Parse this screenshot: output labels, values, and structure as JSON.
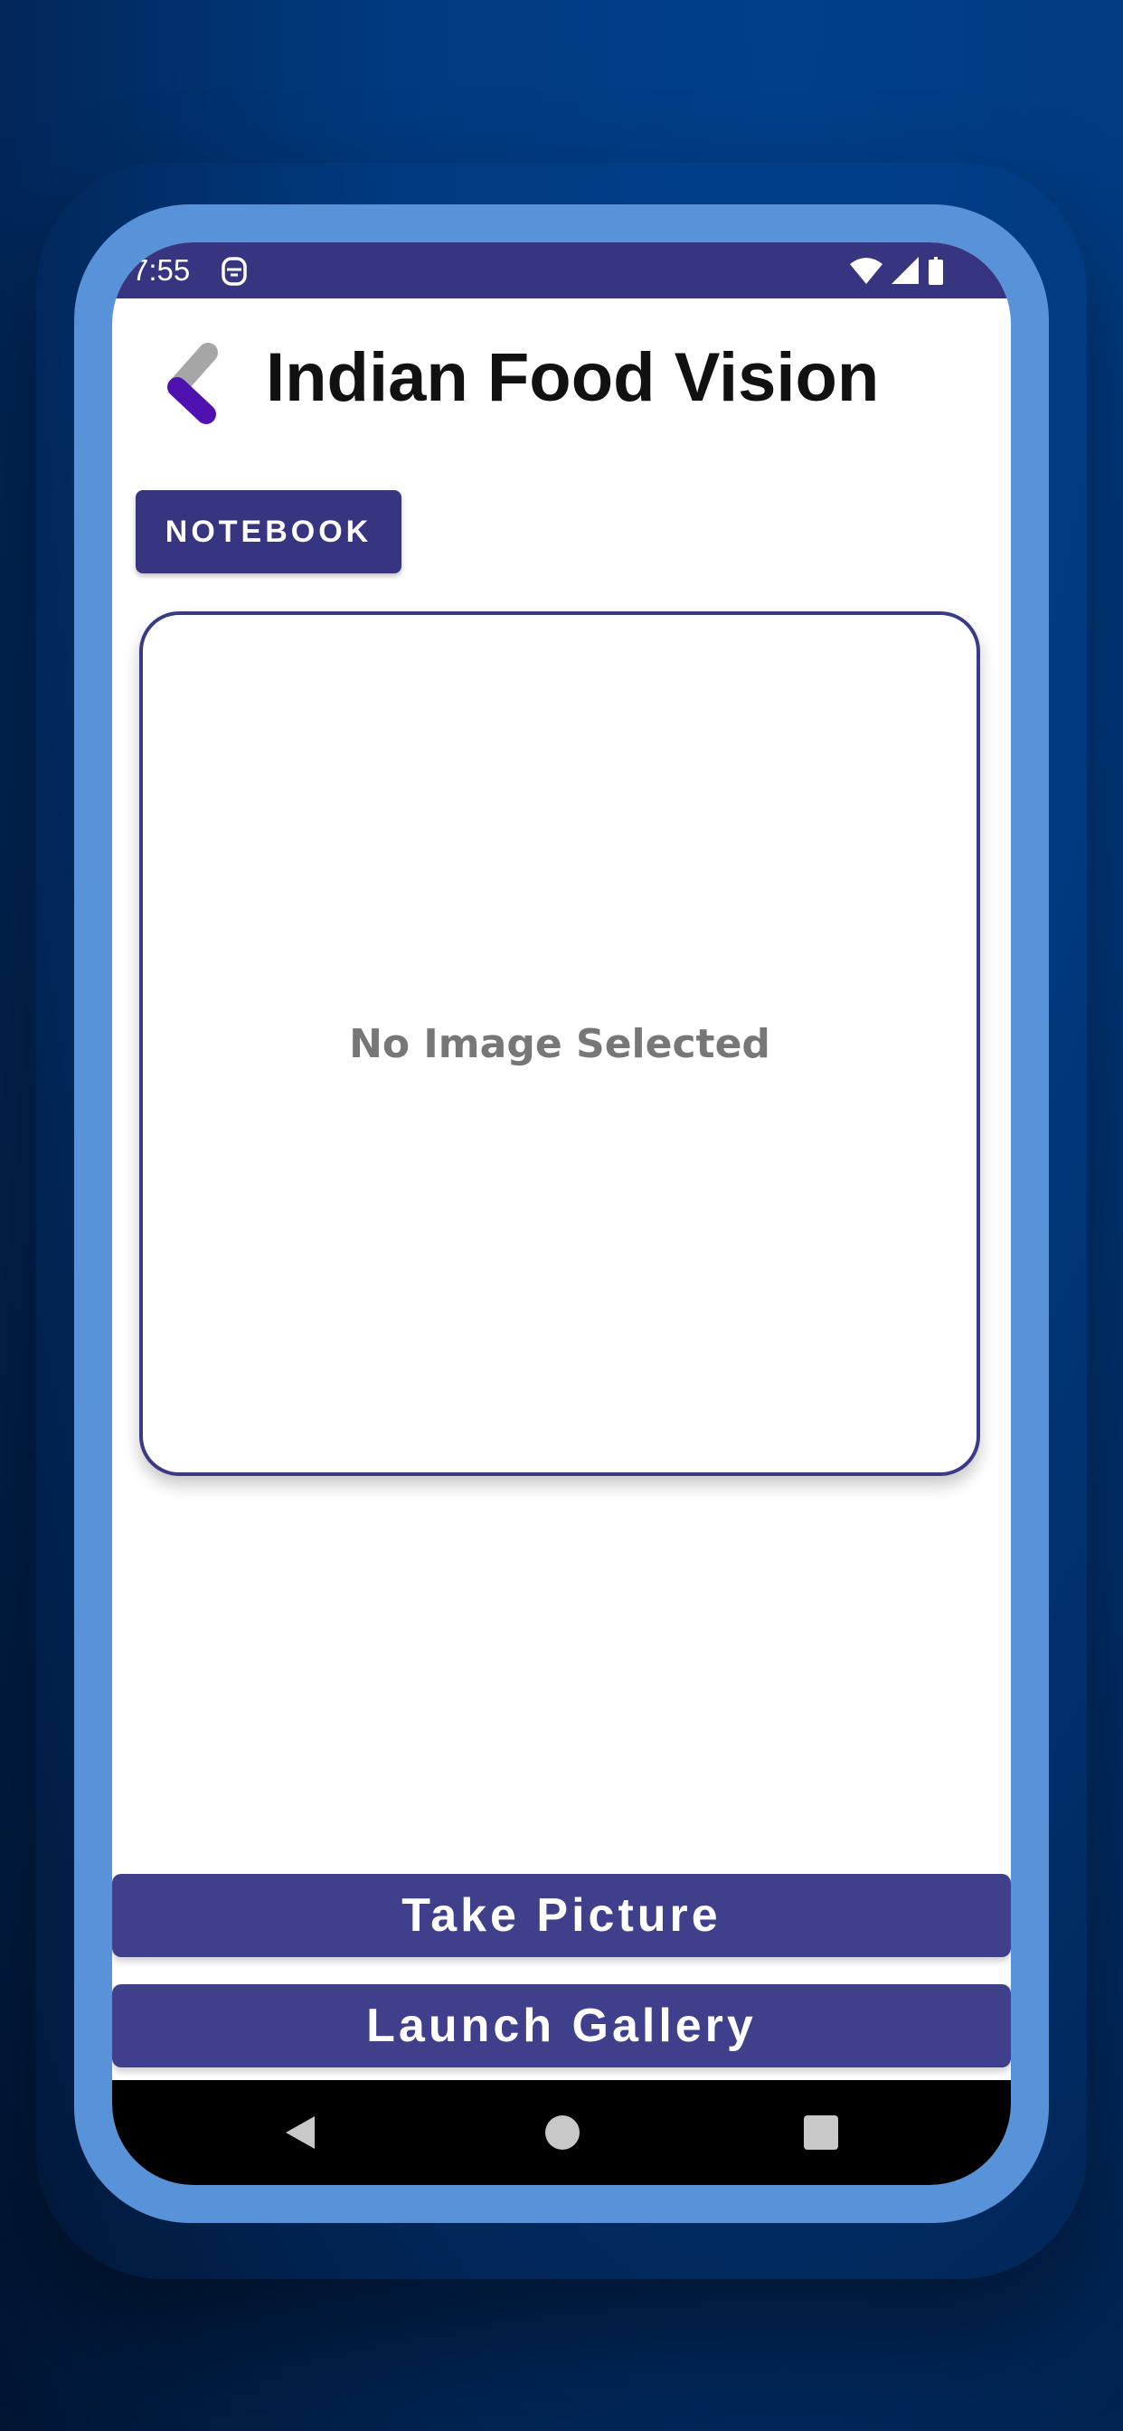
{
  "status_bar": {
    "time": "7:55",
    "icons": [
      "sim-card-icon",
      "wifi-icon",
      "signal-icon",
      "battery-icon"
    ]
  },
  "header": {
    "title": "Indian Food Vision",
    "logo_icon": "app-logo-icon"
  },
  "toolbar": {
    "notebook_label": "NOTEBOOK"
  },
  "image_preview": {
    "placeholder_text": "No Image Selected"
  },
  "actions": {
    "take_picture_label": "Take Picture",
    "launch_gallery_label": "Launch Gallery"
  },
  "navigation": {
    "icons": [
      "back-icon",
      "home-icon",
      "recents-icon"
    ]
  },
  "colors": {
    "primary": "#373580",
    "button": "#3f3f8c",
    "frame": "#5893d9",
    "logo_purple": "#4f12b0",
    "logo_gray": "#a6a6a6"
  }
}
